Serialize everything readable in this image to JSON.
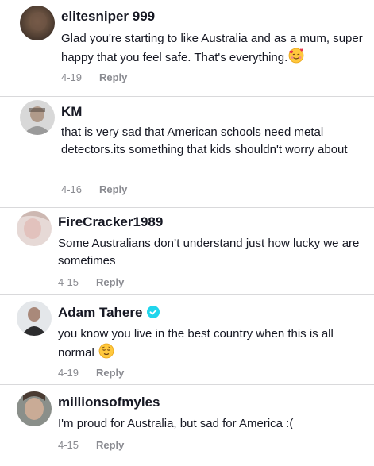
{
  "comments": [
    {
      "username": "elitesniper 999",
      "text": "Glad you're starting to like Australia and as a mum, super happy that you feel safe. That's everything.",
      "emoji": "smiling-face-with-hearts",
      "date": "4-19",
      "reply_label": "Reply",
      "verified": false
    },
    {
      "username": "KM",
      "text": "that is very sad that American schools need metal detectors.its something that kids shouldn't worry about",
      "date": "4-16",
      "reply_label": "Reply",
      "verified": false
    },
    {
      "username": "FireCracker1989",
      "text": "Some Australians don’t understand just how lucky we are sometimes",
      "date": "4-15",
      "reply_label": "Reply",
      "verified": false
    },
    {
      "username": "Adam Tahere",
      "text": "you know you live in the best country when this is all normal",
      "emoji": "relieved-face",
      "date": "4-19",
      "reply_label": "Reply",
      "verified": true
    },
    {
      "username": "millionsofmyles",
      "text": "I'm proud for Australia, but sad for America :(",
      "date": "4-15",
      "reply_label": "Reply",
      "verified": false
    }
  ],
  "colors": {
    "username": "#161823",
    "meta": "#8a8b91",
    "divider": "#d9d9db",
    "verified": "#20d5ec"
  }
}
